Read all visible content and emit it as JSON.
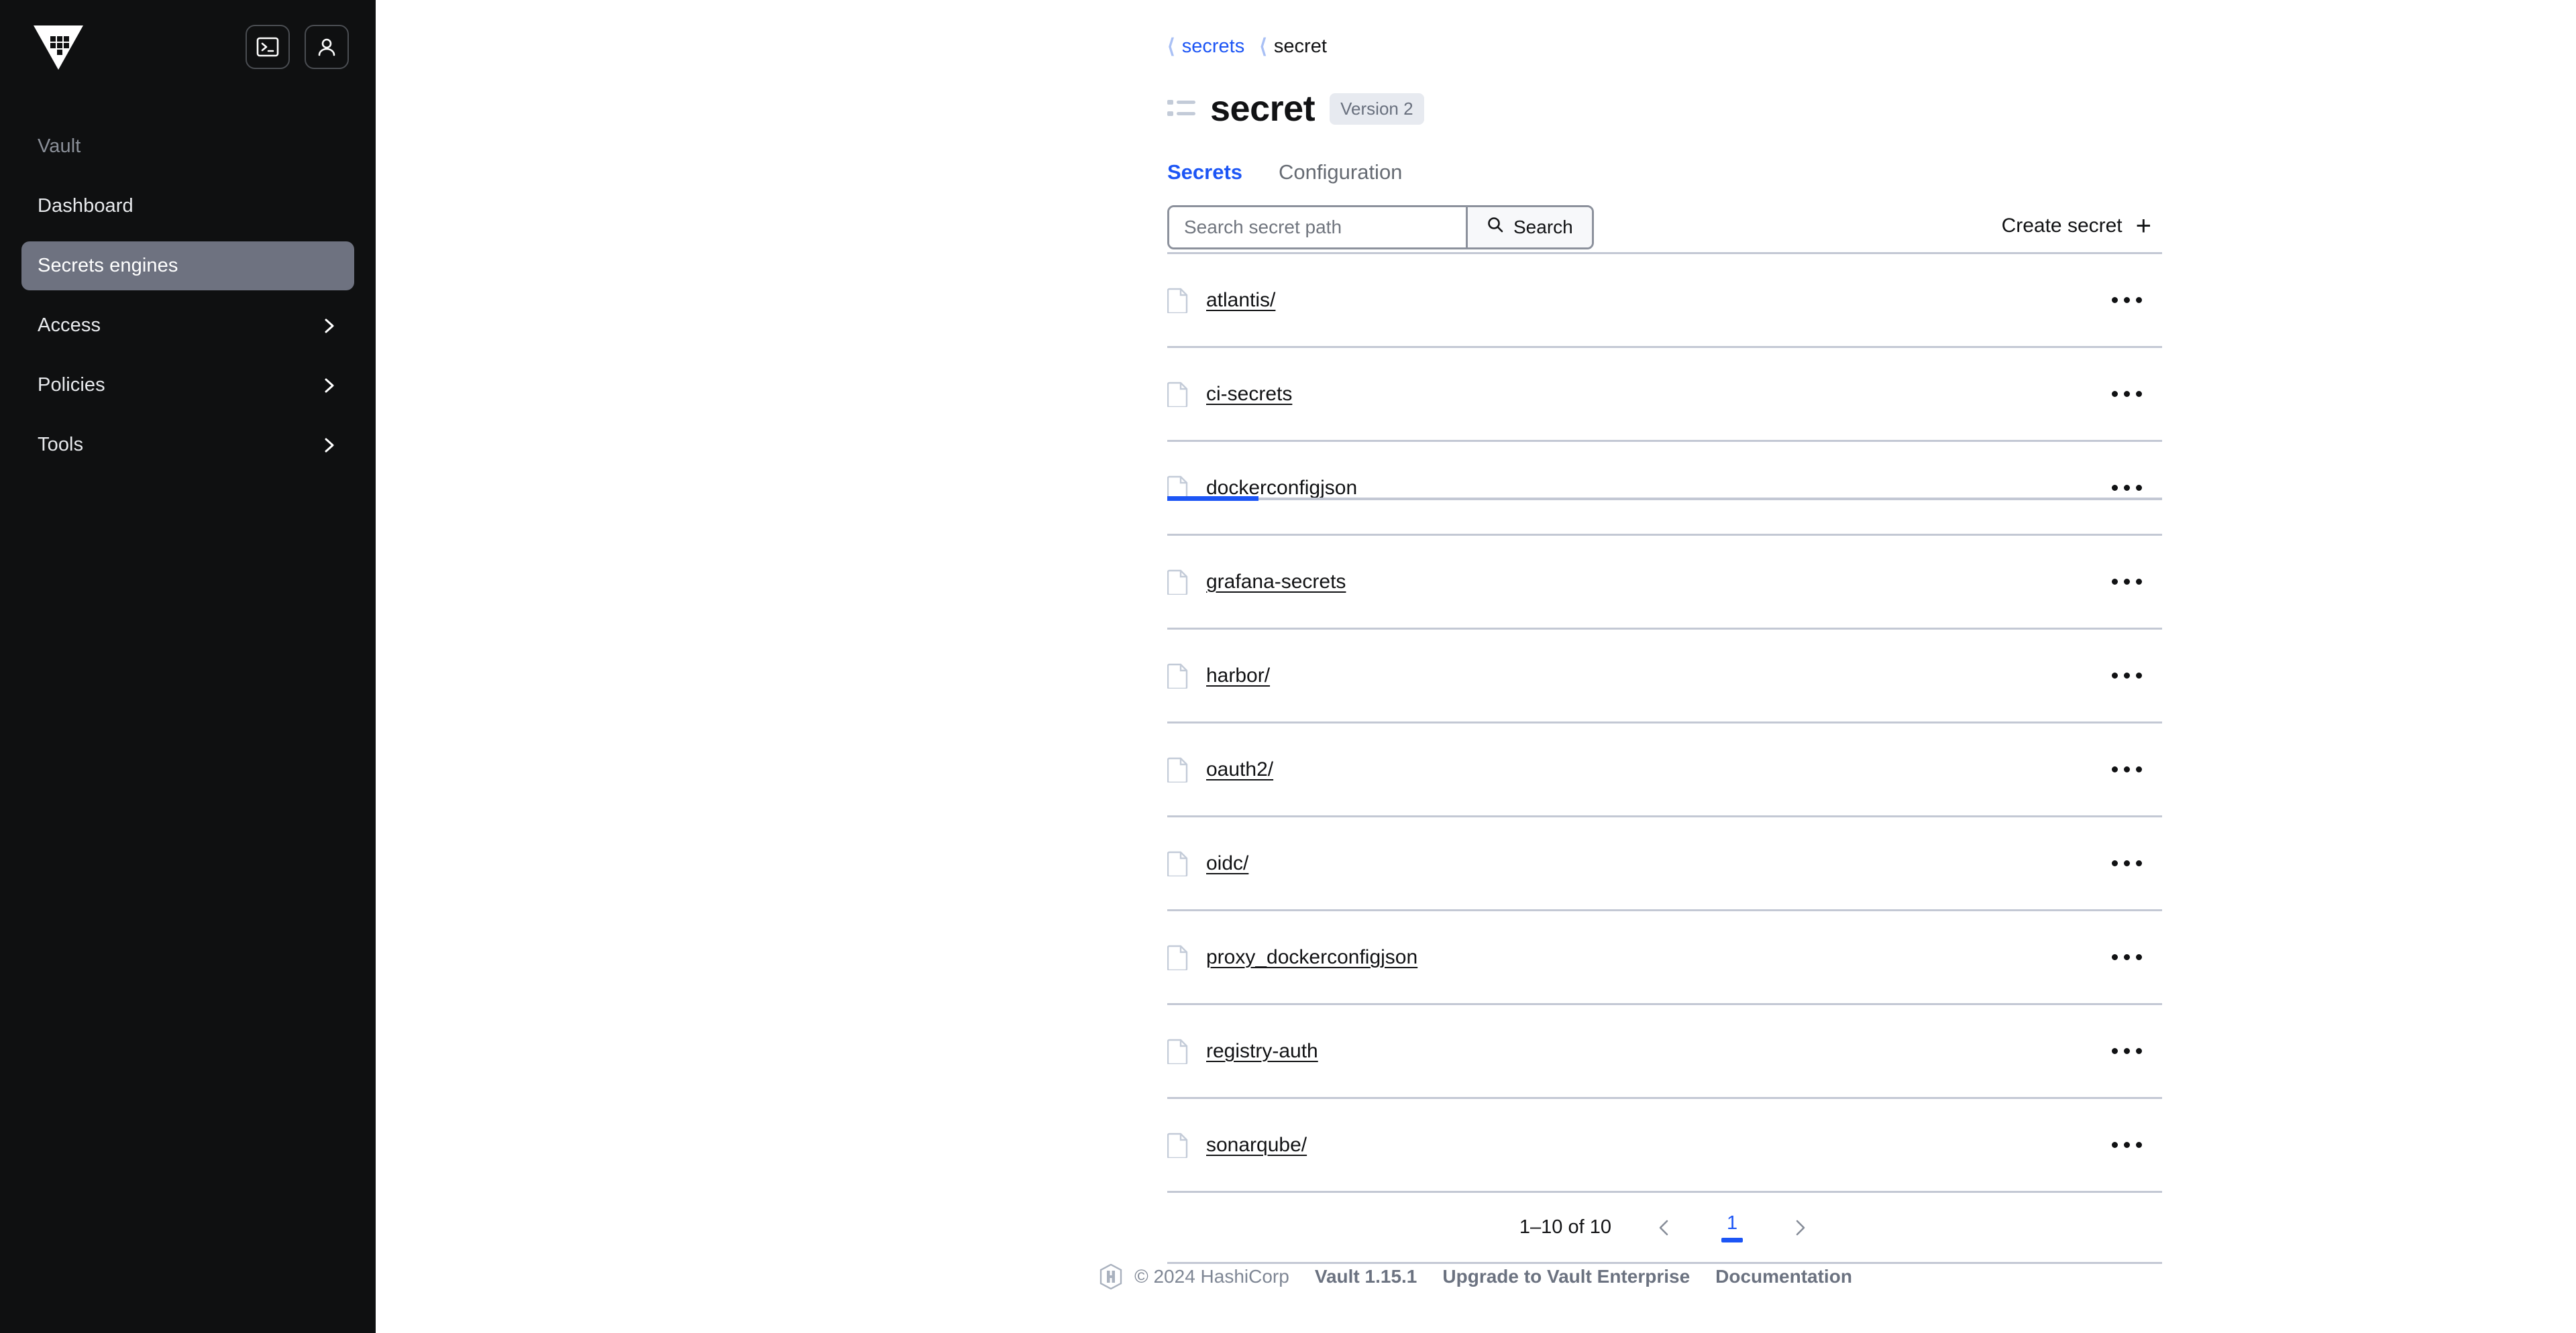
{
  "sidebar": {
    "logo_name": "vault-logo",
    "top_icons": [
      {
        "name": "console-icon",
        "label": "Console"
      },
      {
        "name": "user-icon",
        "label": "User menu"
      }
    ],
    "section_label": "Vault",
    "items": [
      {
        "label": "Dashboard",
        "active": false,
        "has_chevron": false
      },
      {
        "label": "Secrets engines",
        "active": true,
        "has_chevron": false
      },
      {
        "label": "Access",
        "active": false,
        "has_chevron": true
      },
      {
        "label": "Policies",
        "active": false,
        "has_chevron": true
      },
      {
        "label": "Tools",
        "active": false,
        "has_chevron": true
      }
    ]
  },
  "breadcrumb": {
    "parent": "secrets",
    "current": "secret"
  },
  "page": {
    "title": "secret",
    "badge": "Version 2"
  },
  "tabs": [
    {
      "label": "Secrets",
      "active": true
    },
    {
      "label": "Configuration",
      "active": false
    }
  ],
  "toolbar": {
    "search_placeholder": "Search secret path",
    "search_value": "",
    "search_button": "Search",
    "create_button": "Create secret"
  },
  "secrets": [
    {
      "name": "atlantis/"
    },
    {
      "name": "ci-secrets"
    },
    {
      "name": "dockerconfigjson"
    },
    {
      "name": "grafana-secrets"
    },
    {
      "name": "harbor/"
    },
    {
      "name": "oauth2/"
    },
    {
      "name": "oidc/"
    },
    {
      "name": "proxy_dockerconfigjson"
    },
    {
      "name": "registry-auth"
    },
    {
      "name": "sonarqube/"
    }
  ],
  "pagination": {
    "range_label": "1–10 of 10",
    "current_page": "1"
  },
  "footer": {
    "copyright": "© 2024 HashiCorp",
    "version": "Vault 1.15.1",
    "upgrade_link": "Upgrade to Vault Enterprise",
    "docs_link": "Documentation"
  },
  "colors": {
    "accent_blue": "#1c55f5",
    "sidebar_bg": "#0f1011",
    "active_nav_bg": "#6e7280",
    "divider": "#c3c8d4",
    "muted_text": "#7e8694"
  }
}
